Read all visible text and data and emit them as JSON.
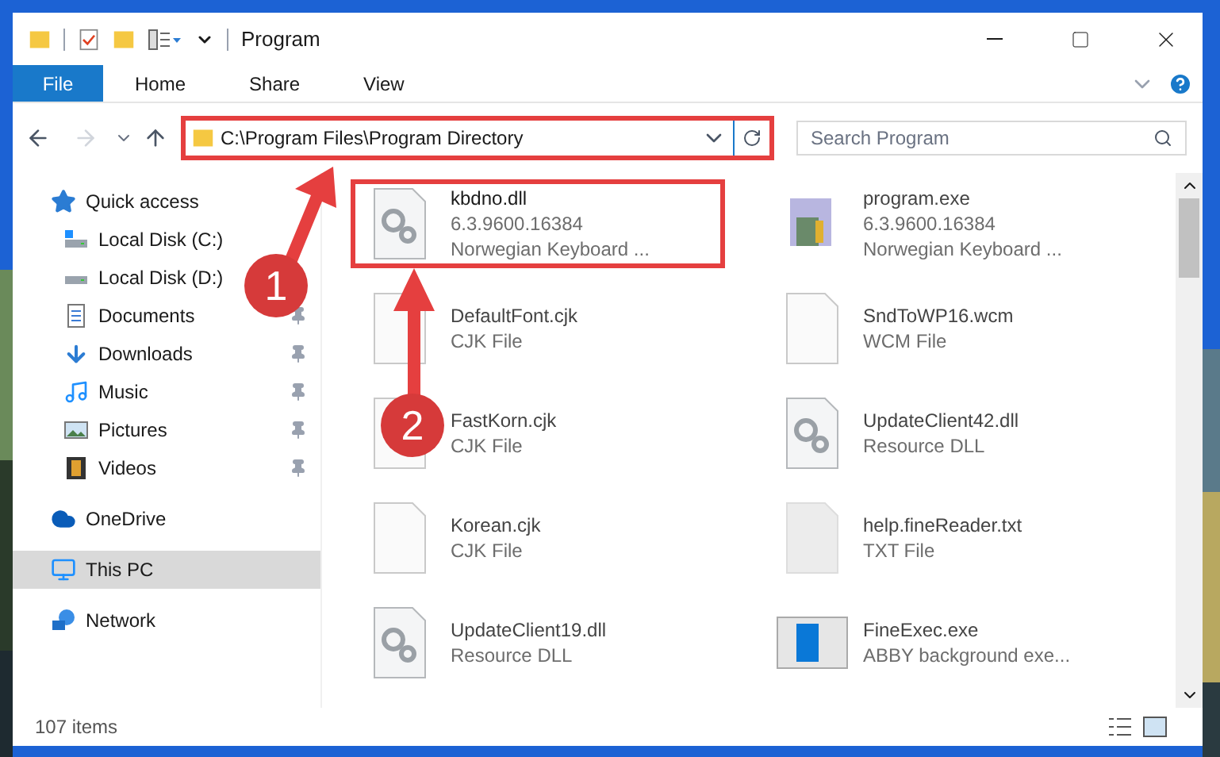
{
  "window": {
    "title": "Program"
  },
  "ribbon_tabs": [
    {
      "label": "File",
      "selected": true
    },
    {
      "label": "Home",
      "selected": false
    },
    {
      "label": "Share",
      "selected": false
    },
    {
      "label": "View",
      "selected": false
    }
  ],
  "address": {
    "value": "C:\\Program Files\\Program Directory"
  },
  "search": {
    "placeholder": "Search Program"
  },
  "sidebar": {
    "items": [
      {
        "label": "Quick access",
        "kind": "star",
        "pinned": false,
        "selected": false,
        "children": [
          {
            "label": "Local Disk (C:)",
            "kind": "diskc",
            "pinned": false,
            "selected": false
          },
          {
            "label": "Local Disk (D:)",
            "kind": "disk",
            "pinned": false,
            "selected": false
          },
          {
            "label": "Documents",
            "kind": "docs",
            "pinned": true,
            "selected": false
          },
          {
            "label": "Downloads",
            "kind": "download",
            "pinned": true,
            "selected": false
          },
          {
            "label": "Music",
            "kind": "music",
            "pinned": true,
            "selected": false
          },
          {
            "label": "Pictures",
            "kind": "pictures",
            "pinned": true,
            "selected": false
          },
          {
            "label": "Videos",
            "kind": "videos",
            "pinned": true,
            "selected": false
          }
        ]
      },
      {
        "label": "OneDrive",
        "kind": "cloud",
        "pinned": false,
        "selected": false
      },
      {
        "label": "This PC",
        "kind": "pc",
        "pinned": false,
        "selected": true
      },
      {
        "label": "Network",
        "kind": "network",
        "pinned": false,
        "selected": false
      }
    ]
  },
  "files": [
    {
      "name": "kbdno.dll",
      "lines": [
        "6.3.9600.16384",
        "Norwegian Keyboard ..."
      ],
      "kind": "dll",
      "highlighted": true
    },
    {
      "name": "program.exe",
      "lines": [
        "6.3.9600.16384",
        "Norwegian Keyboard ..."
      ],
      "kind": "setup",
      "highlighted": false
    },
    {
      "name": "DefaultFont.cjk",
      "lines": [
        "CJK File"
      ],
      "kind": "blank",
      "highlighted": false
    },
    {
      "name": "SndToWP16.wcm",
      "lines": [
        "WCM File"
      ],
      "kind": "blank",
      "highlighted": false
    },
    {
      "name": "FastKorn.cjk",
      "lines": [
        "CJK File"
      ],
      "kind": "blank",
      "highlighted": false
    },
    {
      "name": "UpdateClient42.dll",
      "lines": [
        "Resource DLL"
      ],
      "kind": "dll",
      "highlighted": false
    },
    {
      "name": "Korean.cjk",
      "lines": [
        "CJK File"
      ],
      "kind": "blank",
      "highlighted": false
    },
    {
      "name": "help.fineReader.txt",
      "lines": [
        "TXT File"
      ],
      "kind": "text",
      "highlighted": false
    },
    {
      "name": "UpdateClient19.dll",
      "lines": [
        "Resource DLL"
      ],
      "kind": "dll",
      "highlighted": false
    },
    {
      "name": "FineExec.exe",
      "lines": [
        "ABBY background exe..."
      ],
      "kind": "app",
      "highlighted": false
    }
  ],
  "status_bar": {
    "count": "107 items"
  },
  "callouts": [
    {
      "number": "1"
    },
    {
      "number": "2"
    }
  ]
}
